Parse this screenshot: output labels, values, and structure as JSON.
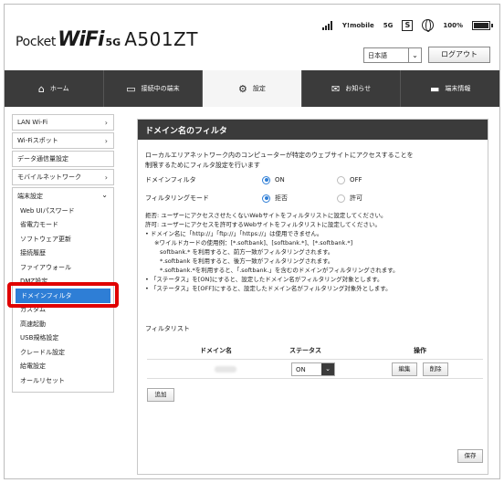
{
  "header": {
    "brand_pocket": "Pocket",
    "brand_wifi": "WiFi",
    "brand_5g": "5G",
    "model": "A501ZT",
    "carrier": "Y!mobile",
    "network": "5G",
    "sim_label": "S",
    "battery": "100%",
    "language": "日本語",
    "logout": "ログアウト"
  },
  "nav": [
    {
      "label": "ホーム",
      "icon": "home-icon"
    },
    {
      "label": "接続中の端末",
      "icon": "devices-icon"
    },
    {
      "label": "設定",
      "icon": "gear-icon"
    },
    {
      "label": "お知らせ",
      "icon": "mail-icon"
    },
    {
      "label": "端末情報",
      "icon": "device-info-icon"
    }
  ],
  "sidebar": {
    "items": [
      {
        "label": "LAN Wi-Fi"
      },
      {
        "label": "Wi-Fiスポット"
      },
      {
        "label": "データ通信量設定"
      },
      {
        "label": "モバイルネットワーク"
      }
    ],
    "group": {
      "label": "端末設定",
      "subitems": [
        "Web UIパスワード",
        "省電力モード",
        "ソフトウェア更新",
        "接続履歴",
        "ファイアウォール",
        "DMZ設定",
        "ドメインフィルタ",
        "カスタム",
        "高速起動",
        "USB規格設定",
        "クレードル設定",
        "給電設定",
        "オールリセット"
      ]
    }
  },
  "main": {
    "title": "ドメイン名のフィルタ",
    "desc_line1": "ローカルエリアネットワーク内のコンピューターが特定のウェブサイトにアクセスすることを",
    "desc_line2": "制限するためにフィルタ設定を行います",
    "domain_filter_label": "ドメインフィルタ",
    "domain_filter_on": "ON",
    "domain_filter_off": "OFF",
    "filtering_mode_label": "フィルタリングモード",
    "mode_deny": "拒否",
    "mode_allow": "許可",
    "notes": [
      "拒否: ユーザーにアクセスさせたくないWebサイトをフィルタリストに設定してください。",
      "許可: ユーザーにアクセスを許可するWebサイトをフィルタリストに設定してください。",
      "• ドメイン名に「http://」「ftp://」「https://」は使用できません。",
      "※ワイルドカードの使用例：[*.softbank]、[softbank.*]、[*.softbank.*]",
      "softbank.* を利用すると、前方一致がフィルタリングされます。",
      "*.softbank を利用すると、後方一致がフィルタリングされます。",
      "*.softbank.*を利用すると、「.softbank.」を含むのドメインがフィルタリングされます。",
      "• 「ステータス」を[ON]にすると、設定したドメイン名がフィルタリング対象とします。",
      "• 「ステータス」を[OFF]にすると、設定したドメイン名がフィルタリング対象外とします。"
    ],
    "filter_list_label": "フィルタリスト",
    "col_domain": "ドメイン名",
    "col_status": "ステータス",
    "col_operation": "操作",
    "row_status": "ON",
    "edit": "編集",
    "delete": "削除",
    "add": "追加",
    "save": "保存"
  },
  "colors": {
    "accent": "#2e7ed6",
    "nav_bg": "#3b3b3b",
    "highlight": "#e00000"
  }
}
